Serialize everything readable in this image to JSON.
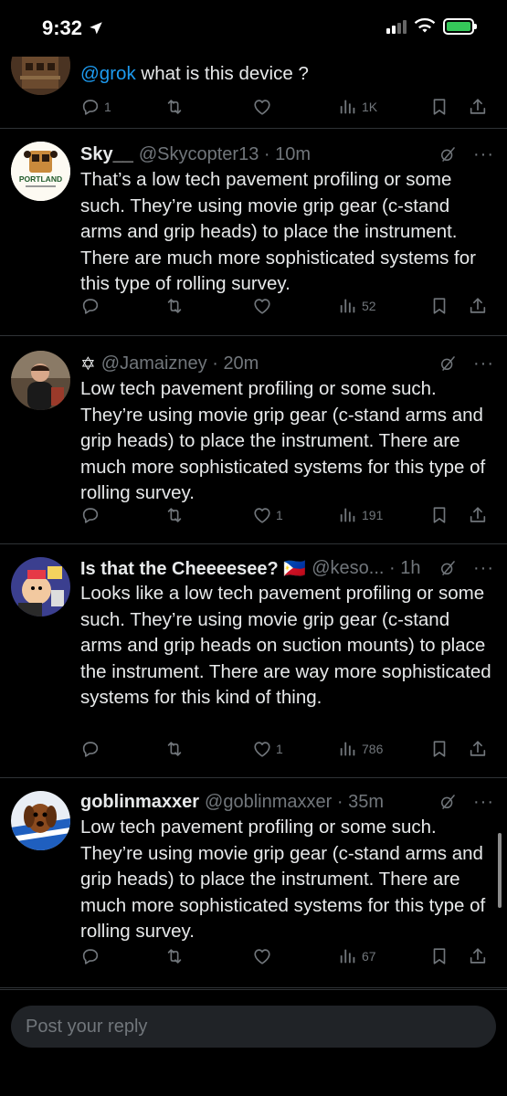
{
  "status_bar": {
    "time": "9:32"
  },
  "reply_bar": {
    "placeholder": "Post your reply"
  },
  "tweets": [
    {
      "mention": "@grok",
      "text": " what is this device ?",
      "stats": {
        "replies": "1",
        "retweets": "",
        "likes": "",
        "views": "1K"
      }
    },
    {
      "name": "Sky__",
      "handle": "@Skycopter13 · 10m",
      "text": "That’s a low tech pavement profiling or some such. They’re using movie grip gear (c-stand arms and grip heads) to place the instrument. There are much more sophisticated systems for this type of rolling survey.",
      "stats": {
        "replies": "",
        "retweets": "",
        "likes": "",
        "views": "52"
      },
      "avatar_text": "PORTLAND"
    },
    {
      "name": "✡",
      "handle": "@Jamaizney · 20m",
      "text": "Low tech pavement profiling or some such. They’re using movie grip gear (c-stand arms and grip heads) to place the instrument. There are much more sophisticated systems for this type of rolling survey.",
      "stats": {
        "replies": "",
        "retweets": "",
        "likes": "1",
        "views": "191"
      }
    },
    {
      "name": "Is that the Cheeeesee? 🇵🇭",
      "handle": "@keso... · 1h",
      "text": "Looks like a low tech pavement profiling or some such. They’re using movie grip gear (c-stand arms and grip heads on suction mounts) to place the instrument. There are way more sophisticated systems for this kind of thing.",
      "stats": {
        "replies": "",
        "retweets": "",
        "likes": "1",
        "views": "786"
      }
    },
    {
      "name": "goblinmaxxer",
      "handle": "@goblinmaxxer · 35m",
      "text": "Low tech pavement profiling or some such. They’re using movie grip gear (c-stand arms and grip heads) to place the instrument. There are much more sophisticated systems for this type of rolling survey.",
      "stats": {
        "replies": "",
        "retweets": "",
        "likes": "",
        "views": "67"
      }
    }
  ],
  "colors": {
    "background": "#000000",
    "text": "#e7e9ea",
    "muted": "#71767b",
    "accent": "#1d9bf0",
    "divider": "#2f3336"
  }
}
